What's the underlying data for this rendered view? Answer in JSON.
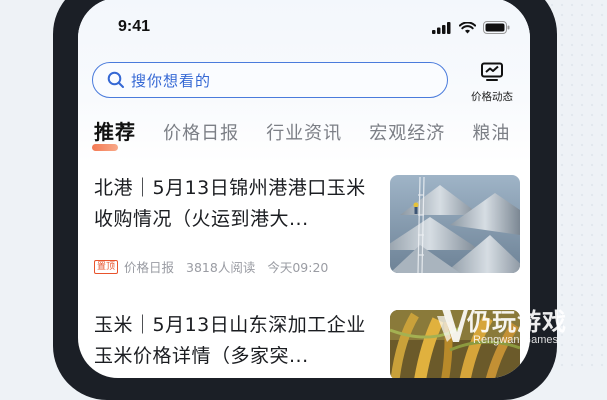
{
  "status_bar": {
    "time": "9:41"
  },
  "search": {
    "placeholder": "搜你想看的"
  },
  "header": {
    "price_dynamic_label": "价格动态"
  },
  "tabs": [
    {
      "label": "推荐",
      "active": true
    },
    {
      "label": "价格日报",
      "active": false
    },
    {
      "label": "行业资讯",
      "active": false
    },
    {
      "label": "宏观经济",
      "active": false
    },
    {
      "label": "粮油",
      "active": false
    }
  ],
  "articles": [
    {
      "title": "北港｜5月13日锦州港港口玉米收购情况（火运到港大...",
      "pinned_badge": "置顶",
      "category": "价格日报",
      "reads": "3818人阅读",
      "time": "今天09:20",
      "thumbnail": "grain-silos-image"
    },
    {
      "title": "玉米｜5月13日山东深加工企业玉米价格详情（多家突...",
      "thumbnail": "corn-field-image"
    }
  ],
  "watermark": {
    "title": "仍玩游戏",
    "subtitle": "Rengwan Games"
  },
  "colors": {
    "accent_blue": "#3568d4",
    "accent_orange": "#f36a3f",
    "phone_frame": "#1b1f26"
  }
}
